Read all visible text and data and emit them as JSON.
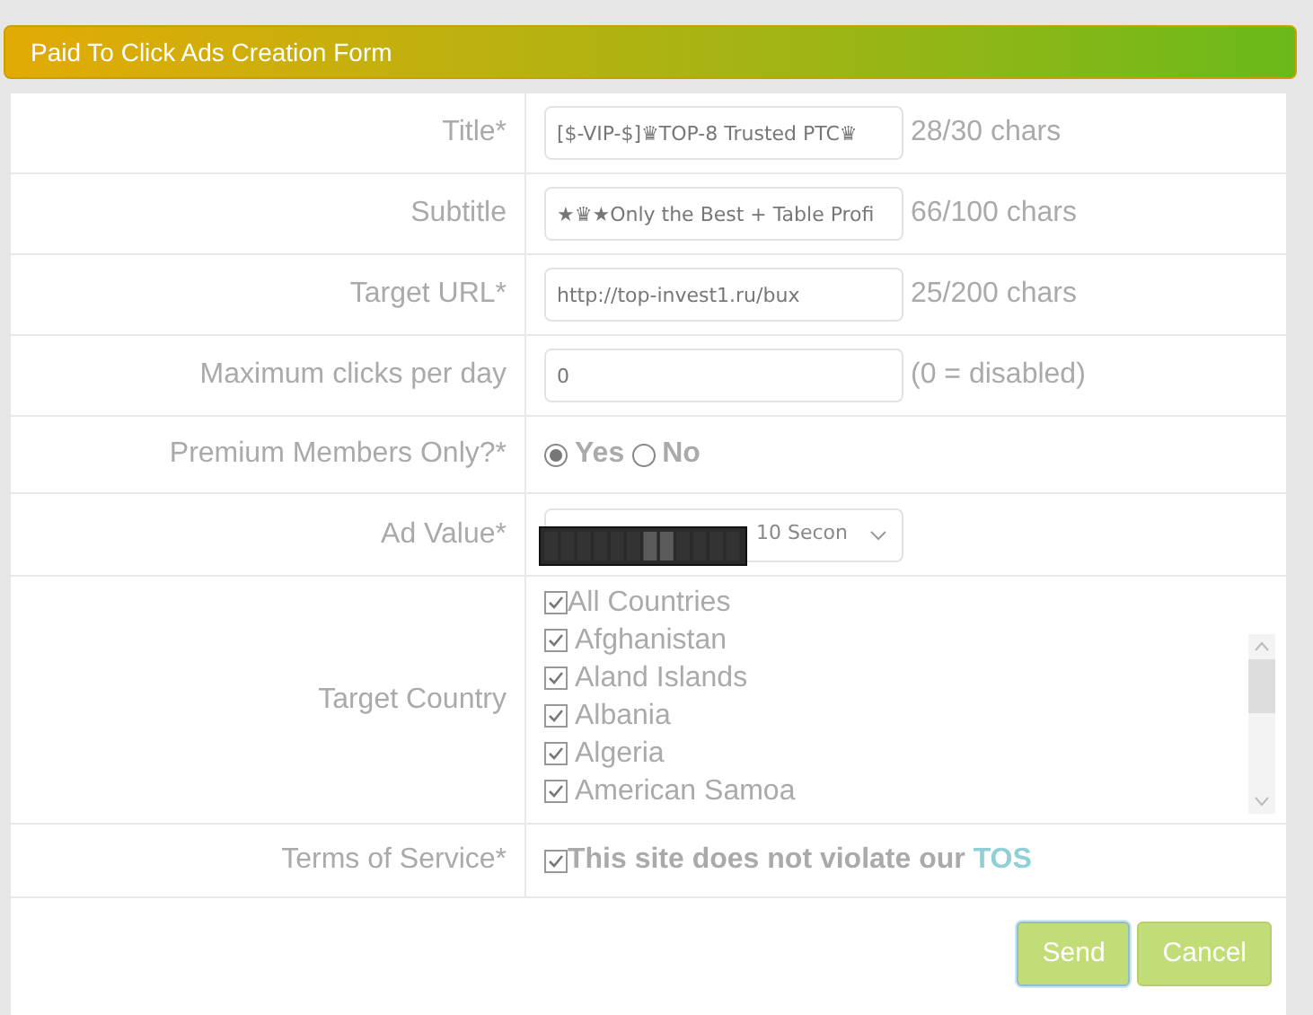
{
  "header": {
    "title": "Paid To Click Ads Creation Form"
  },
  "rows": [
    {
      "kind": "text",
      "label": "Title*",
      "value": "[$-VIP-$]♛TOP-8 Trusted PTC♛",
      "hint": "28/30 chars"
    },
    {
      "kind": "text",
      "label": "Subtitle",
      "value": "★♛★Only the Best + Table Profi",
      "hint": "66/100 chars"
    },
    {
      "kind": "text",
      "label": "Target URL*",
      "value": "http://top-invest1.ru/bux",
      "hint": "25/200 chars"
    },
    {
      "kind": "text",
      "label": "Maximum clicks per day",
      "value": "0",
      "hint": "(0 = disabled)"
    },
    {
      "kind": "radio",
      "label": "Premium Members Only?*",
      "options": [
        {
          "label": "Yes",
          "selected": true
        },
        {
          "label": "No",
          "selected": false
        }
      ]
    },
    {
      "kind": "select",
      "label": "Ad Value*",
      "value": "10 Secon"
    },
    {
      "kind": "checklist",
      "label": "Target Country",
      "items": [
        {
          "label": "All Countries",
          "checked": true
        },
        {
          "label": "Afghanistan",
          "checked": true
        },
        {
          "label": "Aland Islands",
          "checked": true
        },
        {
          "label": "Albania",
          "checked": true
        },
        {
          "label": "Algeria",
          "checked": true
        },
        {
          "label": "American Samoa",
          "checked": true
        }
      ]
    },
    {
      "kind": "terms",
      "label": "Terms of Service*",
      "checked": true,
      "text": "This site does not violate our ",
      "link": "TOS"
    }
  ],
  "buttons": [
    {
      "label": "Send",
      "focused": true
    },
    {
      "label": "Cancel",
      "focused": false
    }
  ]
}
